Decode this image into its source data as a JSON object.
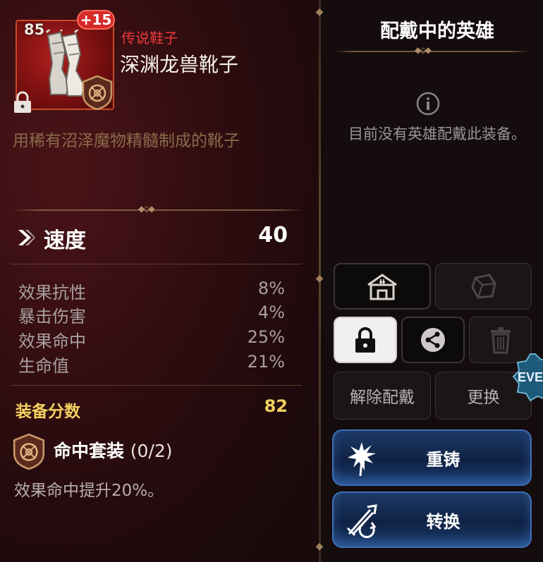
{
  "item": {
    "level": "85",
    "enhance": "+15",
    "rarity": "传说鞋子",
    "name": "深渊龙兽靴子",
    "description": "用稀有沼泽魔物精髓制成的靴子"
  },
  "main_stat": {
    "label": "速度",
    "value": "40",
    "icon": "chevron-right-icon"
  },
  "sub_stats": [
    {
      "label": "效果抗性",
      "value": "8%"
    },
    {
      "label": "暴击伤害",
      "value": "4%"
    },
    {
      "label": "效果命中",
      "value": "25%"
    },
    {
      "label": "生命值",
      "value": "21%"
    }
  ],
  "score": {
    "label": "装备分数",
    "value": "82"
  },
  "set": {
    "name": "命中套装",
    "count": "(0/2)",
    "effect": "效果命中提升20%。"
  },
  "equipped_panel": {
    "title": "配戴中的英雄",
    "empty_text": "目前没有英雄配戴此装备。"
  },
  "buttons": {
    "unequip": "解除配戴",
    "replace": "更换",
    "reforge": "重铸",
    "convert": "转换"
  },
  "event_badge": "EVEN",
  "colors": {
    "rarity_red": "#e83a3a",
    "score_gold": "#f2d060",
    "description_brown": "#8a6b4a",
    "action_blue": "#1d3a66"
  }
}
